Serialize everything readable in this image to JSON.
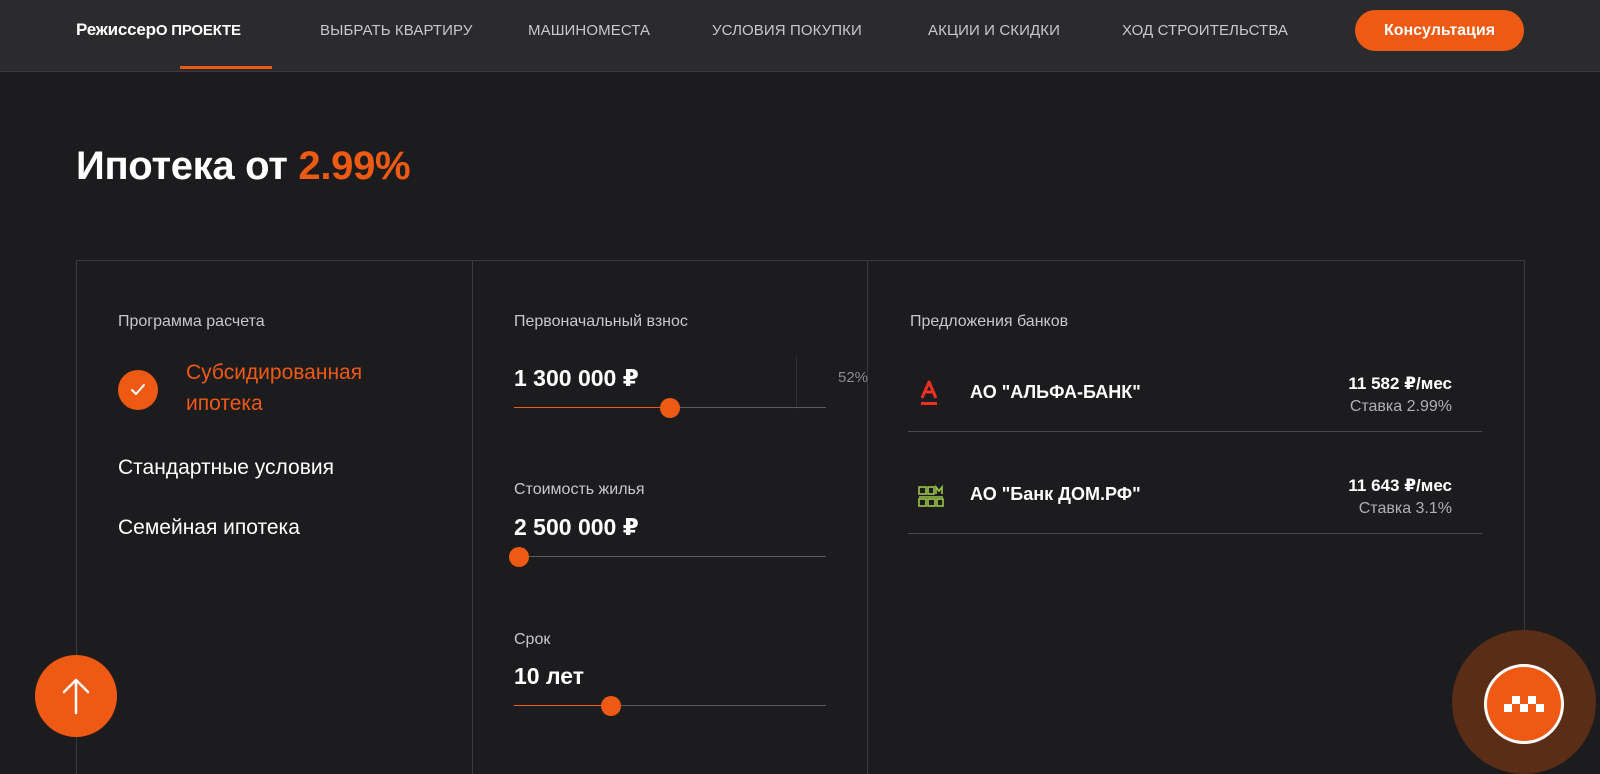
{
  "header": {
    "logo_main": "Режиссер",
    "logo_sub": "О ПРОЕКТЕ",
    "nav": [
      "ВЫБРАТЬ КВАРТИРУ",
      "МАШИНОМЕСТА",
      "УСЛОВИЯ ПОКУПКИ",
      "АКЦИИ И СКИДКИ",
      "ХОД СТРОИТЕЛЬСТВА"
    ],
    "consult_label": "Консультация"
  },
  "title": {
    "text": "Ипотека от ",
    "accent": "2.99%"
  },
  "program": {
    "label": "Программа расчета",
    "items": [
      "Субсидированная ипотека",
      "Стандартные условия",
      "Семейная ипотека"
    ],
    "selected_index": 0
  },
  "params": {
    "down_payment": {
      "label": "Первоначальный взнос",
      "value": "1 300 000 ₽",
      "percent": "52%",
      "level": 0.5
    },
    "price": {
      "label": "Стоимость жилья",
      "value": "2 500 000 ₽",
      "level": 0.02
    },
    "term": {
      "label": "Срок",
      "value": "10 лет",
      "level": 0.31
    }
  },
  "banks": {
    "label": "Предложения банков",
    "items": [
      {
        "name": "АО \"АЛЬФА-БАНК\"",
        "payment": "11 582 ₽/мес",
        "rate": "Ставка 2.99%",
        "logo": "alfa-bank-logo"
      },
      {
        "name": "АО \"Банк ДОМ.РФ\"",
        "payment": "11 643 ₽/мес",
        "rate": "Ставка 3.1%",
        "logo": "domrf-logo"
      }
    ]
  },
  "colors": {
    "accent": "#ee5a14",
    "background": "#1c1c1e",
    "header": "#2b2b2d",
    "alfa_red": "#ef3124",
    "domrf_green": "#9bc34a"
  },
  "icons": {
    "check": "check-icon",
    "scroll_top": "arrow-up-icon",
    "chat": "chat-dots-icon"
  }
}
